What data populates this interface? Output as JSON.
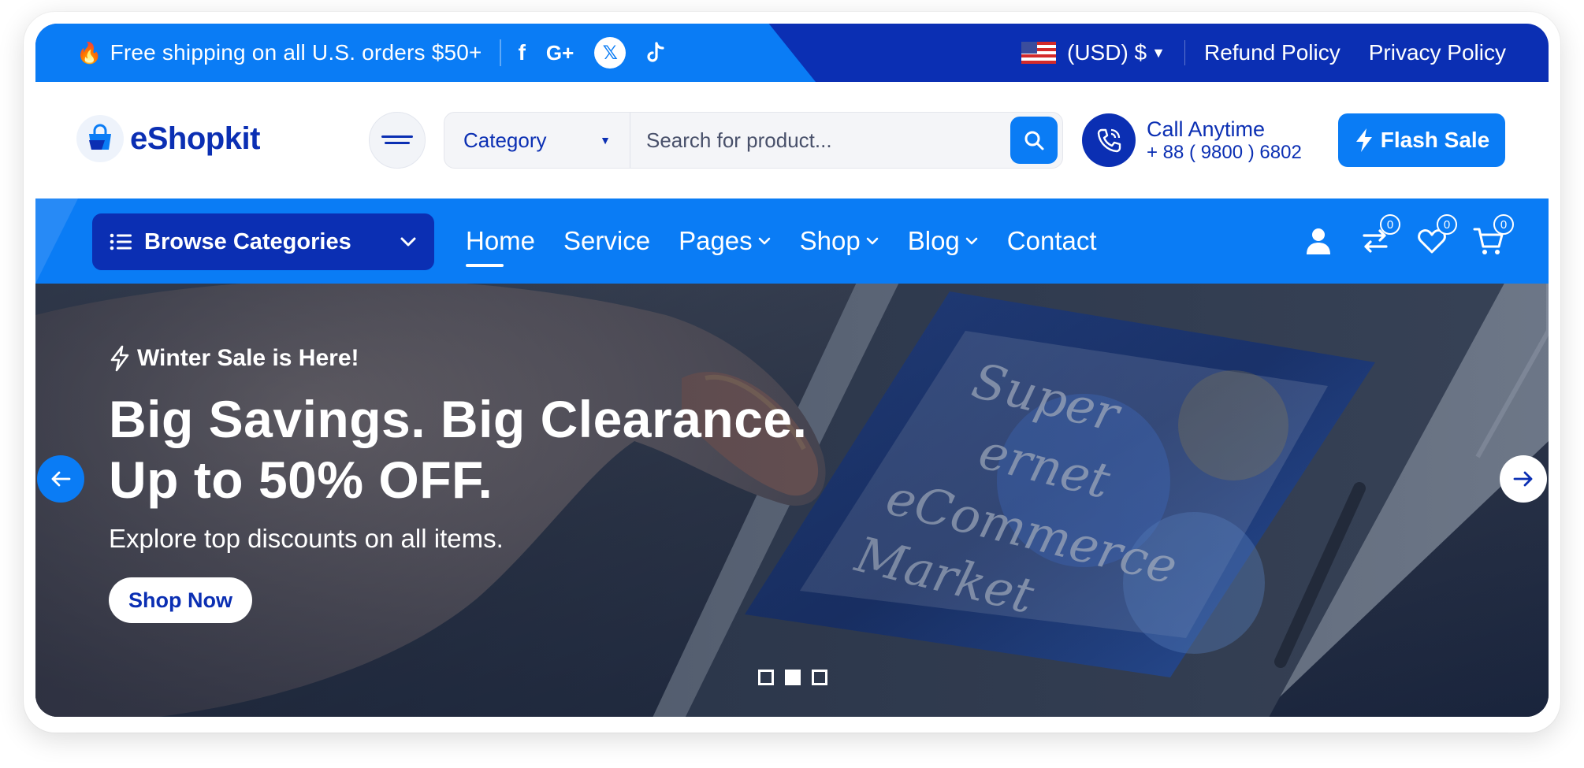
{
  "topbar": {
    "promo_icon": "fire-icon",
    "promo_text": "Free shipping on all U.S. orders $50+",
    "socials": [
      "facebook-icon",
      "google-plus-icon",
      "x-icon",
      "tiktok-icon"
    ],
    "currency": "(USD) $",
    "links": [
      "Refund Policy",
      "Privacy Policy"
    ]
  },
  "header": {
    "logo_text": "eShopkit",
    "search": {
      "category_label": "Category",
      "placeholder": "Search for product..."
    },
    "call": {
      "title": "Call Anytime",
      "phone": "+ 88 ( 9800 ) 6802"
    },
    "flash_sale_label": "Flash Sale"
  },
  "nav": {
    "browse_label": "Browse Categories",
    "items": [
      {
        "label": "Home",
        "active": true,
        "dropdown": false
      },
      {
        "label": "Service",
        "active": false,
        "dropdown": false
      },
      {
        "label": "Pages",
        "active": false,
        "dropdown": true
      },
      {
        "label": "Shop",
        "active": false,
        "dropdown": true
      },
      {
        "label": "Blog",
        "active": false,
        "dropdown": true
      },
      {
        "label": "Contact",
        "active": false,
        "dropdown": false
      }
    ],
    "counts": {
      "compare": "0",
      "wishlist": "0",
      "cart": "0"
    }
  },
  "hero": {
    "eyebrow": "Winter Sale is Here!",
    "headline_line1": "Big Savings. Big Clearance.",
    "headline_line2": "Up to 50% OFF.",
    "subtext": "Explore top discounts on all items.",
    "cta_label": "Shop Now",
    "image_text": [
      "Super",
      "ernet",
      "eCommerce",
      "Market"
    ],
    "slides_total": 3,
    "active_slide": 2
  },
  "colors": {
    "primary": "#0a7cf5",
    "dark_blue": "#0b2fb3",
    "white": "#ffffff"
  }
}
